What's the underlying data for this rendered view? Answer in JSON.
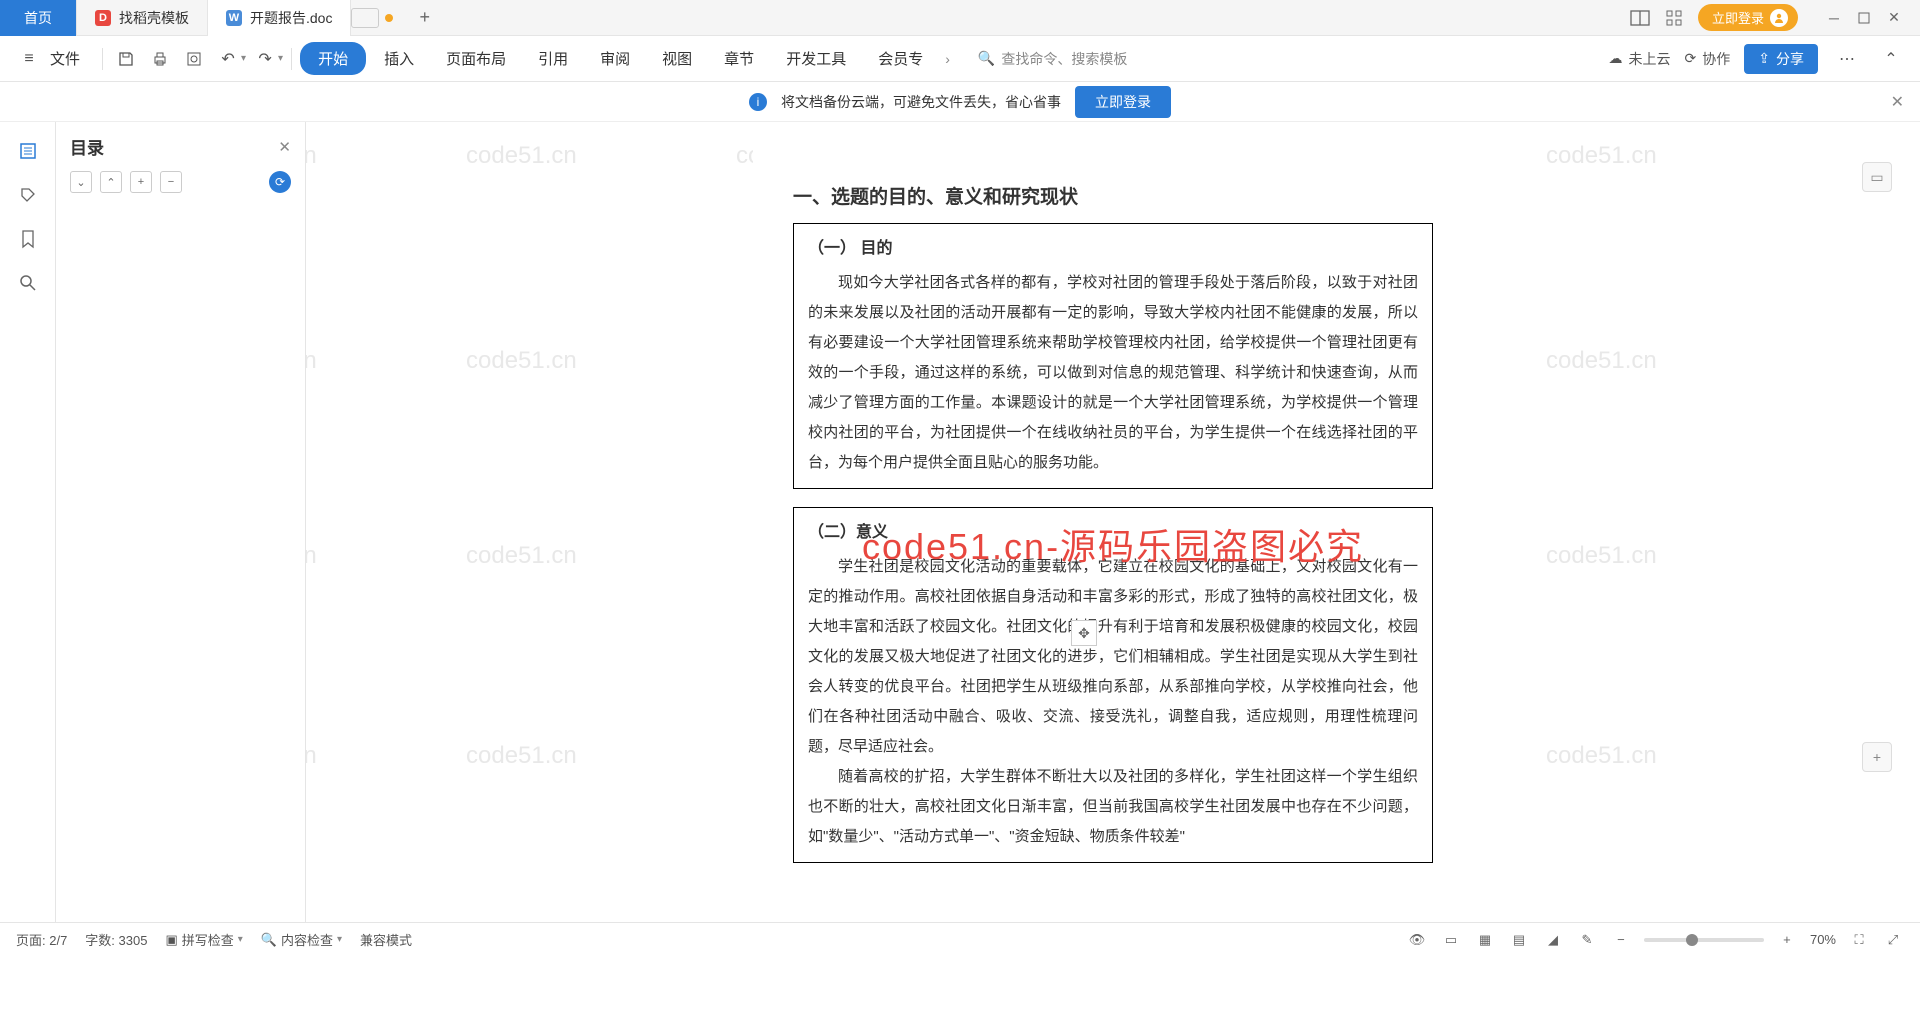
{
  "tabs": {
    "home": "首页",
    "tpl": "找稻壳模板",
    "doc": "开题报告.doc"
  },
  "login_pill": "立即登录",
  "toolbar": {
    "file": "文件"
  },
  "menu": [
    "开始",
    "插入",
    "页面布局",
    "引用",
    "审阅",
    "视图",
    "章节",
    "开发工具",
    "会员专"
  ],
  "search_placeholder": "查找命令、搜索模板",
  "cloud": "未上云",
  "collab": "协作",
  "share": "分享",
  "banner": {
    "text": "将文档备份云端，可避免文件丢失，省心省事",
    "btn": "立即登录"
  },
  "outline": {
    "title": "目录"
  },
  "doc": {
    "h1": "一、选题的目的、意义和研究现状",
    "s1_h": "（一）  目的",
    "s1_p": "现如今大学社团各式各样的都有，学校对社团的管理手段处于落后阶段，以致于对社团的未来发展以及社团的活动开展都有一定的影响，导致大学校内社团不能健康的发展，所以有必要建设一个大学社团管理系统来帮助学校管理校内社团，给学校提供一个管理社团更有效的一个手段，通过这样的系统，可以做到对信息的规范管理、科学统计和快速查询，从而减少了管理方面的工作量。本课题设计的就是一个大学社团管理系统，为学校提供一个管理校内社团的平台，为社团提供一个在线收纳社员的平台，为学生提供一个在线选择社团的平台，为每个用户提供全面且贴心的服务功能。",
    "s2_h": "（二）意义",
    "s2_p1": "学生社团是校园文化活动的重要载体，它建立在校园文化的基础上，又对校园文化有一定的推动作用。高校社团依据自身活动和丰富多彩的形式，形成了独特的高校社团文化，极大地丰富和活跃了校园文化。社团文化的提升有利于培育和发展积极健康的校园文化，校园文化的发展又极大地促进了社团文化的进步，它们相辅相成。学生社团是实现从大学生到社会人转变的优良平台。社团把学生从班级推向系部，从系部推向学校，从学校推向社会，他们在各种社团活动中融合、吸收、交流、接受洗礼，调整自我，适应规则，用理性梳理问题，尽早适应社会。",
    "s2_p2": "随着高校的扩招，大学生群体不断壮大以及社团的多样化，学生社团这样一个学生组织也不断的壮大，高校社团文化日渐丰富，但当前我国高校学生社团发展中也存在不少问题，如\"数量少\"、\"活动方式单一\"、\"资金短缺、物质条件较差\""
  },
  "overlay": "code51.cn-源码乐园盗图必究",
  "watermark": "code51.cn",
  "status": {
    "page": "页面: 2/7",
    "words": "字数: 3305",
    "spell": "拼写检查",
    "content": "内容检查",
    "compat": "兼容模式",
    "zoom": "70%"
  }
}
